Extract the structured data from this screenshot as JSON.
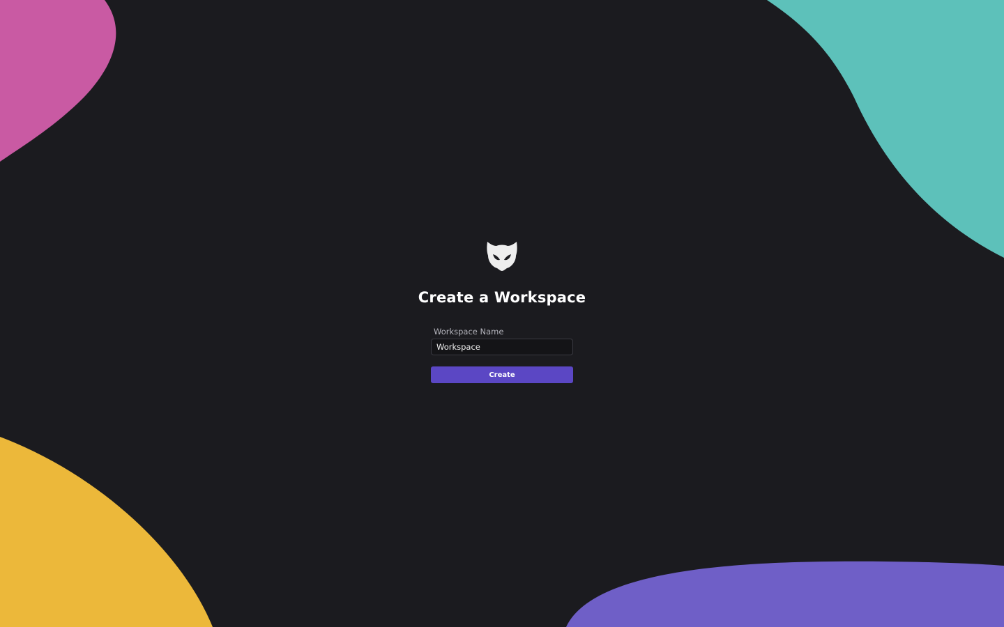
{
  "page": {
    "title": "Create a Workspace"
  },
  "form": {
    "name_label": "Workspace Name",
    "name_value": "Workspace",
    "submit_label": "Create"
  },
  "logo": {
    "icon": "masked-cat-head-logo"
  },
  "colors": {
    "background": "#1b1b1f",
    "blob_pink": "#c95aa3",
    "blob_teal": "#5dc1ba",
    "blob_yellow": "#ecb83a",
    "blob_purple": "#6f5fc7",
    "button": "#5b47c4"
  }
}
